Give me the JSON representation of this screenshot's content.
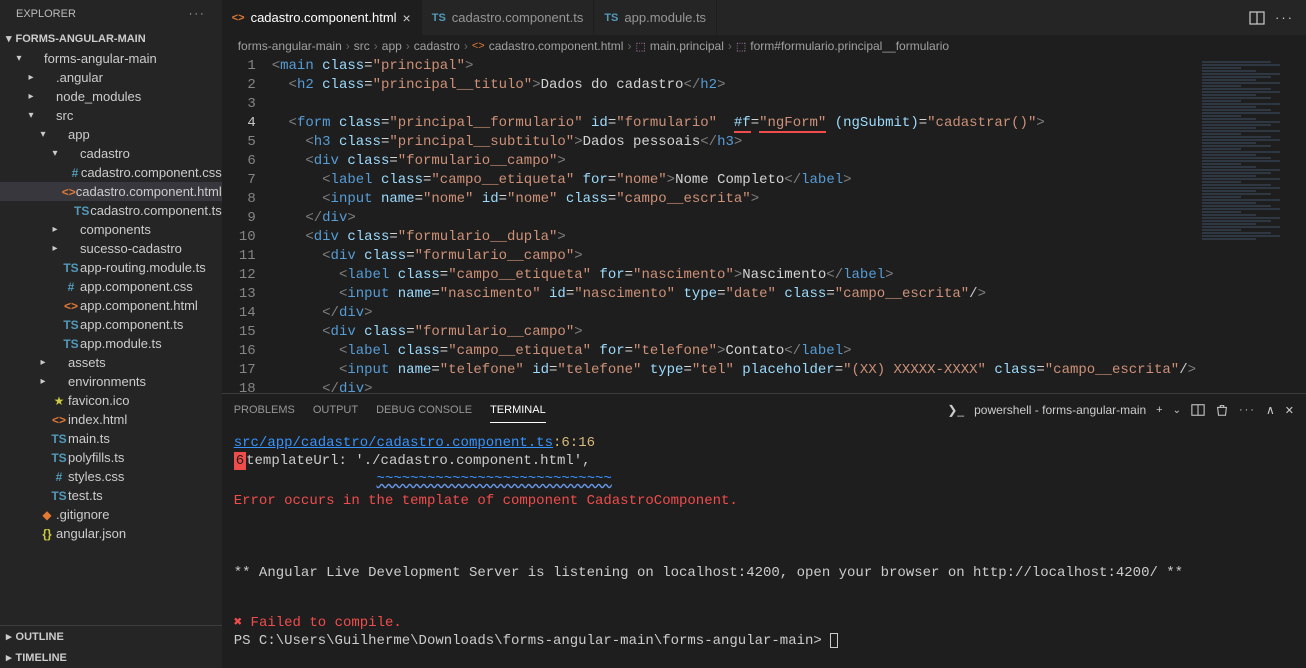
{
  "explorer": {
    "title": "EXPLORER",
    "project": "FORMS-ANGULAR-MAIN",
    "tree": [
      {
        "depth": 1,
        "kind": "folder-open",
        "label": "forms-angular-main"
      },
      {
        "depth": 2,
        "kind": "folder",
        "label": ".angular"
      },
      {
        "depth": 2,
        "kind": "folder",
        "label": "node_modules"
      },
      {
        "depth": 2,
        "kind": "folder-open",
        "label": "src"
      },
      {
        "depth": 3,
        "kind": "folder-open",
        "label": "app"
      },
      {
        "depth": 4,
        "kind": "folder-open",
        "label": "cadastro"
      },
      {
        "depth": 5,
        "kind": "css",
        "label": "cadastro.component.css"
      },
      {
        "depth": 5,
        "kind": "html",
        "label": "cadastro.component.html",
        "active": true
      },
      {
        "depth": 5,
        "kind": "ts",
        "label": "cadastro.component.ts"
      },
      {
        "depth": 4,
        "kind": "folder",
        "label": "components"
      },
      {
        "depth": 4,
        "kind": "folder",
        "label": "sucesso-cadastro"
      },
      {
        "depth": 4,
        "kind": "ts",
        "label": "app-routing.module.ts"
      },
      {
        "depth": 4,
        "kind": "css",
        "label": "app.component.css"
      },
      {
        "depth": 4,
        "kind": "html",
        "label": "app.component.html"
      },
      {
        "depth": 4,
        "kind": "ts",
        "label": "app.component.ts"
      },
      {
        "depth": 4,
        "kind": "ts",
        "label": "app.module.ts"
      },
      {
        "depth": 3,
        "kind": "folder",
        "label": "assets"
      },
      {
        "depth": 3,
        "kind": "folder",
        "label": "environments"
      },
      {
        "depth": 3,
        "kind": "star",
        "label": "favicon.ico"
      },
      {
        "depth": 3,
        "kind": "html",
        "label": "index.html"
      },
      {
        "depth": 3,
        "kind": "ts",
        "label": "main.ts"
      },
      {
        "depth": 3,
        "kind": "ts",
        "label": "polyfills.ts"
      },
      {
        "depth": 3,
        "kind": "css",
        "label": "styles.css"
      },
      {
        "depth": 3,
        "kind": "ts",
        "label": "test.ts"
      },
      {
        "depth": 2,
        "kind": "git",
        "label": ".gitignore"
      },
      {
        "depth": 2,
        "kind": "json",
        "label": "angular.json"
      }
    ],
    "bottomSections": [
      "OUTLINE",
      "TIMELINE"
    ]
  },
  "tabs": [
    {
      "icon": "html",
      "label": "cadastro.component.html",
      "active": true,
      "close": true
    },
    {
      "icon": "ts",
      "label": "cadastro.component.ts",
      "active": false
    },
    {
      "icon": "ts",
      "label": "app.module.ts",
      "active": false
    }
  ],
  "breadcrumbs": [
    {
      "text": "forms-angular-main"
    },
    {
      "text": "src"
    },
    {
      "text": "app"
    },
    {
      "text": "cadastro"
    },
    {
      "text": "cadastro.component.html",
      "icon": "html"
    },
    {
      "text": "main.principal",
      "icon": "sym"
    },
    {
      "text": "form#formulario.principal__formulario",
      "icon": "sym"
    }
  ],
  "code": {
    "startLine": 1,
    "currentLine": 4,
    "lines": [
      "<main class=\"principal\">",
      "  <h2 class=\"principal__titulo\">Dados do cadastro</h2>",
      "",
      "  <form class=\"principal__formulario\" id=\"formulario\"  #f=\"ngForm\" (ngSubmit)=\"cadastrar()\">",
      "    <h3 class=\"principal__subtitulo\">Dados pessoais</h3>",
      "    <div class=\"formulario__campo\">",
      "      <label class=\"campo__etiqueta\" for=\"nome\">Nome Completo</label>",
      "      <input name=\"nome\" id=\"nome\" class=\"campo__escrita\">",
      "    </div>",
      "    <div class=\"formulario__dupla\">",
      "      <div class=\"formulario__campo\">",
      "        <label class=\"campo__etiqueta\" for=\"nascimento\">Nascimento</label>",
      "        <input name=\"nascimento\" id=\"nascimento\" type=\"date\" class=\"campo__escrita\"/>",
      "      </div>",
      "      <div class=\"formulario__campo\">",
      "        <label class=\"campo__etiqueta\" for=\"telefone\">Contato</label>",
      "        <input name=\"telefone\" id=\"telefone\" type=\"tel\" placeholder=\"(XX) XXXXX-XXXX\" class=\"campo__escrita\"/>",
      "      </div>"
    ]
  },
  "panel": {
    "tabs": [
      "PROBLEMS",
      "OUTPUT",
      "DEBUG CONSOLE",
      "TERMINAL"
    ],
    "activeTab": "TERMINAL",
    "terminalLabel": "powershell - forms-angular-main",
    "lines": {
      "src": "src/app/cadastro/cadastro.component.ts",
      "loc": ":6:16",
      "lineNum": "6",
      "templateUrl": "    templateUrl: './cadastro.component.html',",
      "squigStart": "                 ",
      "squig": "~~~~~~~~~~~~~~~~~~~~~~~~~~~~",
      "error": "Error occurs in the template of component CadastroComponent.",
      "live": "** Angular Live Development Server is listening on localhost:4200, open your browser on http://localhost:4200/ **",
      "fail": "✖ Failed to compile.",
      "prompt": "PS C:\\Users\\Guilherme\\Downloads\\forms-angular-main\\forms-angular-main> "
    }
  }
}
